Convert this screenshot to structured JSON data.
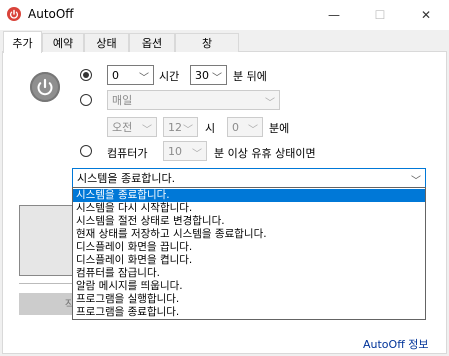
{
  "window": {
    "title": "AutoOff",
    "minimize": "—",
    "maximize": "☐",
    "close": "✕"
  },
  "tabs": [
    "추가",
    "예약",
    "상태",
    "옵션",
    "창"
  ],
  "schedule": {
    "hours": "0",
    "hours_unit": "시간",
    "minutes": "30",
    "minutes_suffix": "분 뒤에",
    "repeat": "매일",
    "ampm": "오전",
    "hour": "12",
    "hour_unit": "시",
    "minute": "0",
    "minute_suffix": "분에",
    "idle_label": "컴퓨터가",
    "idle_minutes": "10",
    "idle_suffix": "분 이상 유휴 상태이면"
  },
  "action": {
    "selected": "시스템을 종료합니다.",
    "options": [
      "시스템을 종료합니다.",
      "시스템을 다시 시작합니다.",
      "시스템을 절전 상태로 변경합니다.",
      "현재 상태를 저장하고 시스템을 종료합니다.",
      "디스플레이 화면을 끕니다.",
      "디스플레이 화면을 켭니다.",
      "컴퓨터를 잠급니다.",
      "알람 메시지를 띄웁니다.",
      "프로그램을 실행합니다.",
      "프로그램을 종료합니다."
    ]
  },
  "add_button_partial": "작",
  "footer": {
    "about": "AutoOff 정보"
  }
}
